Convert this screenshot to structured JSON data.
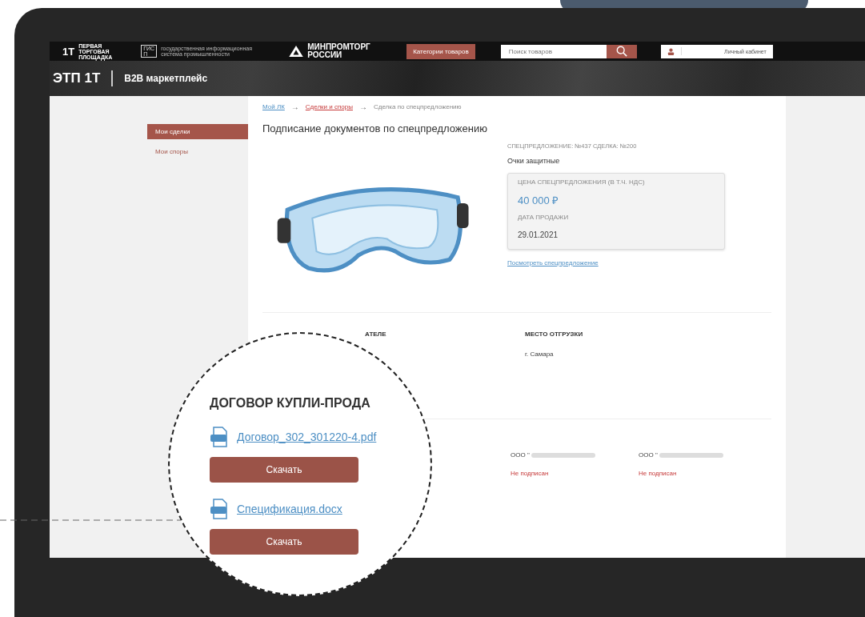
{
  "header": {
    "logo_mark": "1Т",
    "logo_text": "ПЕРВАЯ ТОРГОВАЯ ПЛОЩАДКА",
    "gisp_mark": "ГИСП",
    "gisp_text": "государственная информационная система промышленности",
    "ministry": "МИНПРОМТОРГ РОССИИ",
    "categories_button": "Категории товаров",
    "search": {
      "placeholder": "Поиск товаров"
    },
    "account": "Личный кабинет"
  },
  "banner": {
    "title": "ЭТП 1Т",
    "subtitle": "B2B маркетплейс"
  },
  "sidebar": {
    "items": [
      {
        "label": "Мои сделки",
        "selected": true
      },
      {
        "label": "Мои споры",
        "selected": false
      }
    ]
  },
  "breadcrumb_separator": "→",
  "breadcrumbs": [
    {
      "label": "Мой ЛК",
      "kind": "link"
    },
    {
      "label": "Сделки и споры",
      "kind": "accent"
    },
    {
      "label": "Сделка по спецпредложению",
      "kind": "current"
    }
  ],
  "title": "Подписание документов по спецпредложению",
  "offer": {
    "ids": "СПЕЦПРЕДЛОЖЕНИЕ: №437 СДЕЛКА: №200",
    "name": "Очки защитные",
    "price_label": "ЦЕНА СПЕЦПРЕДЛОЖЕНИЯ (В Т.Ч. НДС)",
    "price": "40 000 ₽",
    "date_label": "ДАТА ПРОДАЖИ",
    "date": "29.01.2021",
    "link": "Посмотреть спецпредложение"
  },
  "details": [
    {
      "heading": "АТЕЛЕ"
    },
    {
      "heading": "МЕСТО ОТГРУЗКИ",
      "value": "г. Самара"
    }
  ],
  "signers": [
    {
      "company": "ООО \"",
      "status": "Не подписан"
    },
    {
      "company": "ООО \"",
      "status": "Не подписан"
    }
  ],
  "magnifier": {
    "heading": "ДОГОВОР КУПЛИ-ПРОДА",
    "files": [
      {
        "name": "Договор_302_301220-4.pdf",
        "button": "Скачать"
      },
      {
        "name": "Спецификация.docx",
        "button": "Скачать"
      }
    ]
  }
}
